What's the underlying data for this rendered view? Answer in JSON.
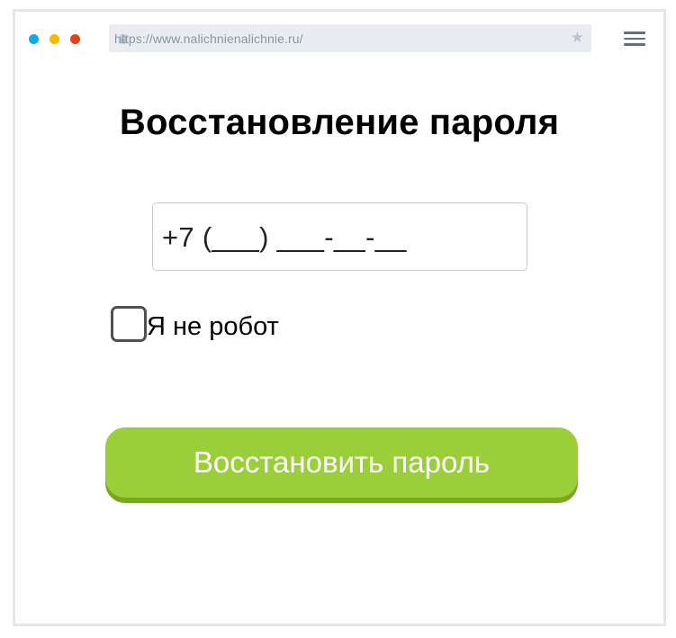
{
  "browser": {
    "url": "https://www.nalichnienalichnie.ru/",
    "icons": {
      "star": "star-icon",
      "menu": "hamburger-menu-icon",
      "lock": "lock-icon"
    },
    "window_dots": [
      {
        "name": "blue",
        "color": "#13a7e8"
      },
      {
        "name": "yellow",
        "color": "#f6b800"
      },
      {
        "name": "red",
        "color": "#e3421b"
      }
    ]
  },
  "form": {
    "title": "Восстановление пароля",
    "phone_input": {
      "value": "+7 (___) ___-__-__"
    },
    "captcha": {
      "label": "Я не робот",
      "checked": false
    },
    "submit_label": "Восстановить пароль"
  },
  "colors": {
    "accent": "#9bcf3a",
    "accent_shadow": "#79a81f",
    "input_border": "#cccccc",
    "checkbox_border": "#505050"
  }
}
